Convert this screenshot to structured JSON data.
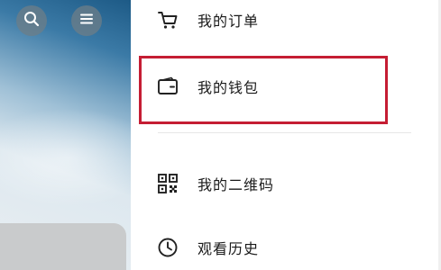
{
  "colors": {
    "highlight": "#c51d33",
    "text": "#1a1a1a",
    "icon": "#222222",
    "divider": "#e6e6e6"
  },
  "backdrop": {
    "buttons": [
      {
        "icon": "search-icon"
      },
      {
        "icon": "menu-icon"
      }
    ]
  },
  "drawer": {
    "items": [
      {
        "label": "我的订单",
        "icon": "cart-icon"
      },
      {
        "label": "我的钱包",
        "icon": "wallet-icon",
        "highlighted": true
      },
      {
        "label": "我的二维码",
        "icon": "qrcode-icon"
      },
      {
        "label": "观看历史",
        "icon": "clock-icon"
      }
    ]
  }
}
